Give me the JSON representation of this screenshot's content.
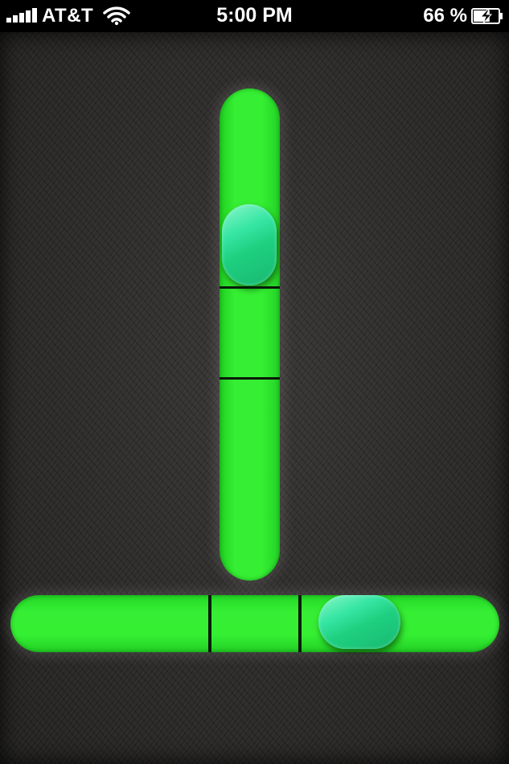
{
  "status_bar": {
    "carrier": "AT&T",
    "time": "5:00 PM",
    "battery_percent": "66 %",
    "battery_level": 0.66
  },
  "levels": {
    "vertical": {
      "bubble_position_fraction": 0.28
    },
    "horizontal": {
      "bubble_position_fraction": 0.76
    }
  },
  "colors": {
    "vial": "#35ef33",
    "bubble": "#2ee6a0",
    "background": "#2e2c2b"
  }
}
